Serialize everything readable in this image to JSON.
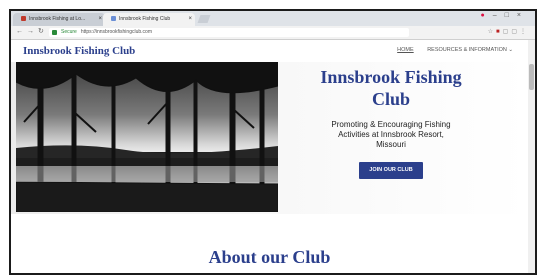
{
  "browser": {
    "tabs": [
      {
        "label": "Innsbrook Fishing at Lo..."
      },
      {
        "label": "Innsbrook Fishing Club"
      }
    ],
    "address": {
      "secure_label": "Secure",
      "url": "https://innsbrookfishingclub.com"
    }
  },
  "site": {
    "logo": "Innsbrook Fishing Club",
    "menu": {
      "home": "HOME",
      "resources": "RESOURCES & INFORMATION"
    },
    "hero": {
      "title_line1": "Innsbrook Fishing",
      "title_line2": "Club",
      "subtitle_line1": "Promoting & Encouraging Fishing",
      "subtitle_line2": "Activities at Innsbrook Resort,",
      "subtitle_line3": "Missouri",
      "cta": "JOIN OUR CLUB"
    },
    "about_heading": "About our Club"
  },
  "colors": {
    "brand": "#2b3f8c",
    "frame": "#1b1b1b"
  }
}
